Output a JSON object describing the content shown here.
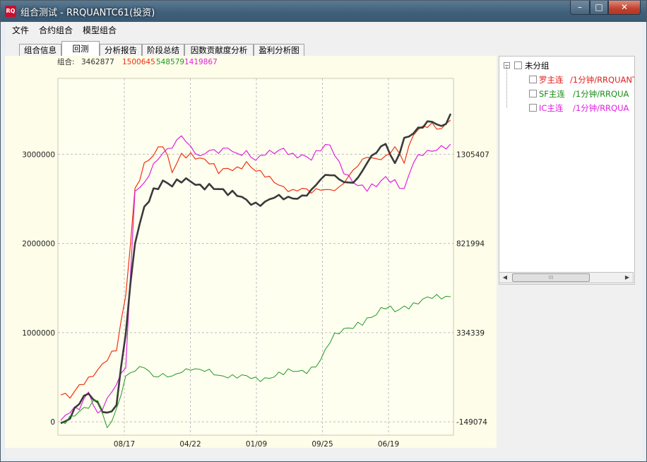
{
  "window": {
    "title": "组合测试 - RRQUANTC61(投资)"
  },
  "title_buttons": {
    "minimize": "–",
    "maximize": "□",
    "close": "✕"
  },
  "menu": [
    {
      "label": "文件"
    },
    {
      "label": "合约组合"
    },
    {
      "label": "模型组合"
    }
  ],
  "tabs": [
    {
      "label": "组合信息",
      "active": false
    },
    {
      "label": "回测",
      "active": true
    },
    {
      "label": "分析报告",
      "active": false
    },
    {
      "label": "阶段总结",
      "active": false
    },
    {
      "label": "因数贡献度分析",
      "active": false
    },
    {
      "label": "盈利分析图",
      "active": false
    }
  ],
  "tree": {
    "group_label": "未分组",
    "items": [
      {
        "name": "罗主连",
        "detail": "/1分钟/RRQUANT",
        "color": "#e0201c"
      },
      {
        "name": "SF主连",
        "detail": "/1分钟/RRQUA",
        "color": "#1a8a1a"
      },
      {
        "name": "IC主连",
        "detail": "/1分钟/RRQUA",
        "color": "#e020e0"
      }
    ]
  },
  "chart_data": {
    "type": "line",
    "header": {
      "label": "组合:",
      "values": [
        "3462877",
        "1500645",
        "548579",
        "1419867"
      ]
    },
    "x_ticks": [
      "08/17",
      "04/22",
      "01/09",
      "09/25",
      "06/19"
    ],
    "y_left": {
      "ticks": [
        "0",
        "1000000",
        "2000000",
        "3000000"
      ],
      "range": [
        -150000,
        3850000
      ]
    },
    "y_right": {
      "ticks": [
        "-149074",
        "334339",
        "821994",
        "1305407"
      ]
    },
    "grid": true,
    "series": [
      {
        "color": "#ee3311",
        "stroke": 1.2,
        "values": [
          300000,
          250000,
          400000,
          500000,
          600000,
          700000,
          800000,
          1400000,
          2600000,
          2900000,
          3000000,
          3100000,
          2800000,
          3000000,
          3000000,
          2950000,
          2900000,
          2800000,
          2850000,
          2850000,
          2900000,
          2800000,
          2750000,
          2700000,
          2650000,
          2600000,
          2600000,
          2550000,
          2600000,
          2620000,
          2650000,
          2750000,
          2850000,
          2950000,
          2950000,
          3000000,
          3100000,
          2900000,
          3200000,
          3300000,
          3350000,
          3300000,
          3400000
        ]
      },
      {
        "color": "#dd22dd",
        "stroke": 1.2,
        "values": [
          0,
          100000,
          150000,
          350000,
          100000,
          250000,
          400000,
          600000,
          2600000,
          2700000,
          2900000,
          3000000,
          3050000,
          3200000,
          3100000,
          3000000,
          3050000,
          3000000,
          3050000,
          3000000,
          3050000,
          2950000,
          3000000,
          3000000,
          3050000,
          3000000,
          3000000,
          2950000,
          3050000,
          3100000,
          2900000,
          2750000,
          2650000,
          2600000,
          2650000,
          2750000,
          2700000,
          2600000,
          2900000,
          3000000,
          3050000,
          3100000,
          3100000
        ]
      },
      {
        "color": "#3a3a3a",
        "stroke": 2.6,
        "values": [
          0,
          50000,
          200000,
          300000,
          200000,
          100000,
          200000,
          1000000,
          2000000,
          2400000,
          2600000,
          2700000,
          2650000,
          2700000,
          2700000,
          2650000,
          2650000,
          2600000,
          2550000,
          2550000,
          2500000,
          2450000,
          2450000,
          2500000,
          2500000,
          2520000,
          2550000,
          2600000,
          2700000,
          2750000,
          2720000,
          2700000,
          2750000,
          2900000,
          3000000,
          3100000,
          2900000,
          3200000,
          3250000,
          3300000,
          3350000,
          3300000,
          3450000
        ]
      },
      {
        "color": "#1f9a1f",
        "stroke": 1.0,
        "values": [
          0,
          50000,
          100000,
          150000,
          250000,
          -50000,
          150000,
          500000,
          550000,
          600000,
          520000,
          560000,
          520000,
          540000,
          560000,
          580000,
          600000,
          540000,
          500000,
          480000,
          500000,
          490000,
          500000,
          520000,
          540000,
          560000,
          560000,
          600000,
          700000,
          900000,
          1000000,
          1050000,
          1100000,
          1150000,
          1200000,
          1280000,
          1250000,
          1300000,
          1320000,
          1360000,
          1380000,
          1390000,
          1420000
        ]
      }
    ]
  }
}
